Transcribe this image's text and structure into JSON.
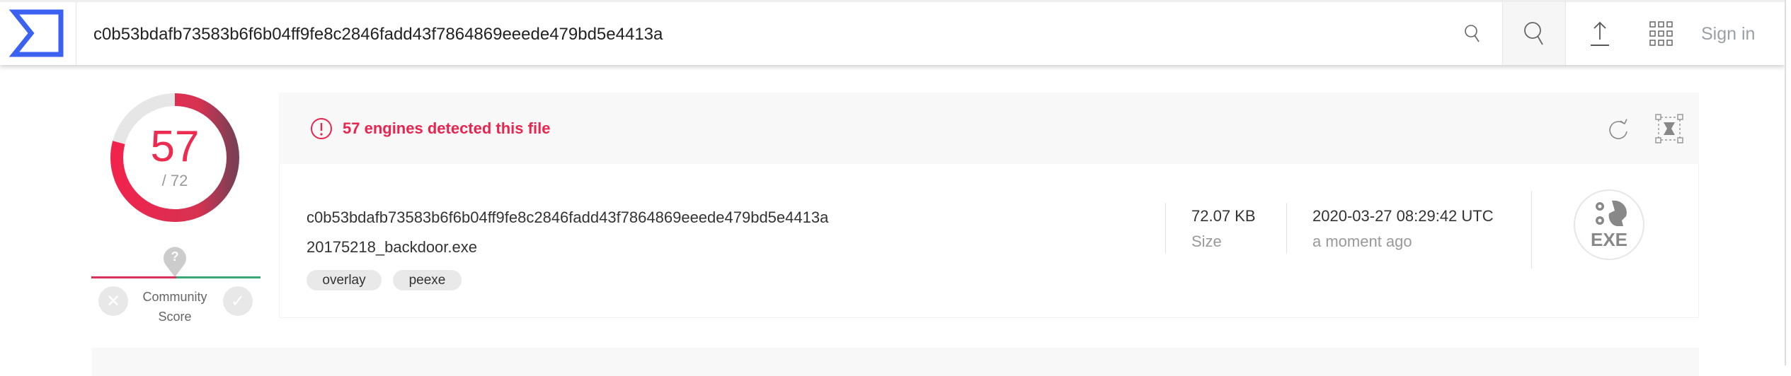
{
  "header": {
    "logo": "virustotal-logo",
    "search_value": "c0b53bdafb73583b6f6b04ff9fe8c2846fadd43f7864869eeede479bd5e4413a",
    "sign_in": "Sign in"
  },
  "score": {
    "detections": "57",
    "total": "/ 72",
    "fraction": 0.7917,
    "accent": "#ed2a4f",
    "community_label_1": "Community",
    "community_label_2": "Score",
    "community_value": "?"
  },
  "alert": {
    "text": "57 engines detected this file"
  },
  "file": {
    "hash": "c0b53bdafb73583b6f6b04ff9fe8c2846fadd43f7864869eeede479bd5e4413a",
    "name": "20175218_backdoor.exe",
    "tags": [
      "overlay",
      "peexe"
    ],
    "size": "72.07 KB",
    "size_label": "Size",
    "date": "2020-03-27 08:29:42 UTC",
    "date_relative": "a moment ago",
    "type_icon_label": "EXE"
  }
}
